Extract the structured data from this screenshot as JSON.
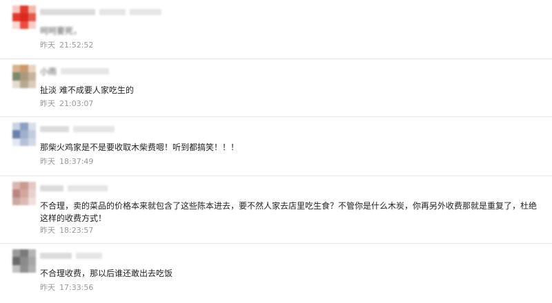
{
  "comments": [
    {
      "username": "",
      "text": "",
      "text_blurred": "呵呵要死，",
      "day": "昨天",
      "time": "21:52:52",
      "avatar_colors": [
        "#f4c7c0",
        "#e23b2c",
        "#f2b8ad",
        "#e4382a",
        "#d92a1e",
        "#e65a4c",
        "#f7d9d4",
        "#ea4c3f",
        "#f5cdc6"
      ]
    },
    {
      "username": "小雨",
      "text": "扯淡 难不成要人家吃生的",
      "day": "昨天",
      "time": "21:03:07",
      "avatar_colors": [
        "#d9b38c",
        "#c89a6e",
        "#e8d4c0",
        "#7a8a6a",
        "#a89a7c",
        "#c7b39c",
        "#e3dcd0",
        "#b7a890",
        "#d8cbb8"
      ]
    },
    {
      "username": "",
      "text": "那柴火鸡家是不是要收取木柴费嗯！听到都搞笑！！！",
      "day": "昨天",
      "time": "18:37:49",
      "avatar_colors": [
        "#c9d3e3",
        "#8da0c2",
        "#d8dfeb",
        "#6b82ad",
        "#9fb0cc",
        "#c4cde0",
        "#e2e7f0",
        "#b5c2d8",
        "#d0d8e6"
      ]
    },
    {
      "username": "",
      "text": "不合理，卖的菜品的价格本来就包含了这些陈本进去，要不然人家去店里吃生食？不管你是什么木炭，你再另外收费那就是重复了，杜绝这样的收费方式！",
      "day": "昨天",
      "time": "18:23:57",
      "avatar_colors": [
        "#d8b8b0",
        "#c89a90",
        "#e3c9c2",
        "#b88880",
        "#d4a69c",
        "#e8d2cc",
        "#c9a9a2",
        "#dcbab3",
        "#efdfdb"
      ]
    },
    {
      "username": "",
      "text": "不合理收费，那以后谁还敢出去吃饭",
      "day": "昨天",
      "time": "17:33:56",
      "avatar_colors": [
        "#9a9a9a",
        "#7a7a7a",
        "#b4b4b4",
        "#6a6a6a",
        "#8a8a8a",
        "#a6a6a6",
        "#c2c2c2",
        "#909090",
        "#b0b0b0"
      ]
    }
  ]
}
